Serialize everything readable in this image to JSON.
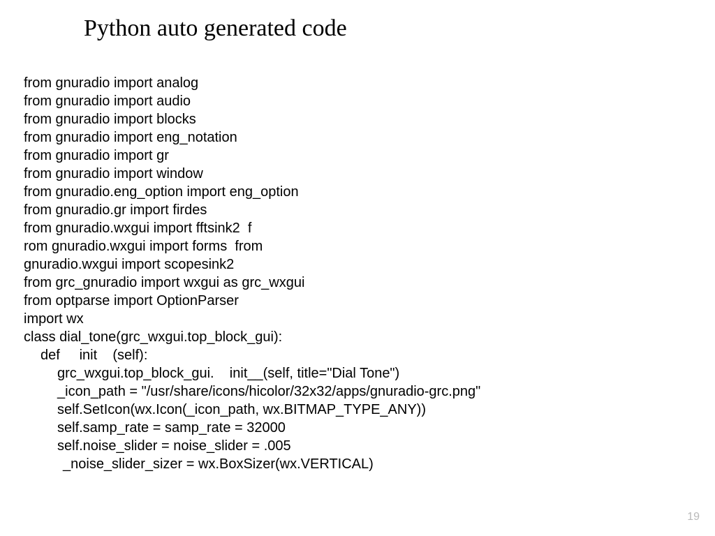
{
  "title": "Python auto generated code",
  "page_number": "19",
  "code": {
    "l1": "from gnuradio import analog",
    "l2": "from gnuradio import audio",
    "l3": "from gnuradio import blocks",
    "l4": "from gnuradio import eng_notation",
    "l5": "from gnuradio import gr",
    "l6": "from gnuradio import window",
    "l7": "from gnuradio.eng_option import eng_option",
    "l8": "from gnuradio.gr import firdes",
    "l9": "from gnuradio.wxgui import fftsink2  f",
    "l10": "rom gnuradio.wxgui import forms  from",
    "l11": "gnuradio.wxgui import scopesink2",
    "l12": "from grc_gnuradio import wxgui as grc_wxgui",
    "l13": "from optparse import OptionParser",
    "l14": "import wx",
    "l15": "class dial_tone(grc_wxgui.top_block_gui):",
    "l16": "def     init    (self):",
    "l17": "grc_wxgui.top_block_gui.    init__(self, title=\"Dial Tone\")",
    "l18": "_icon_path = \"/usr/share/icons/hicolor/32x32/apps/gnuradio-grc.png\"",
    "l19": "self.SetIcon(wx.Icon(_icon_path, wx.BITMAP_TYPE_ANY))",
    "l20": "self.samp_rate = samp_rate = 32000",
    "l21": "self.noise_slider = noise_slider = .005",
    "l22": "_noise_slider_sizer = wx.BoxSizer(wx.VERTICAL)"
  }
}
